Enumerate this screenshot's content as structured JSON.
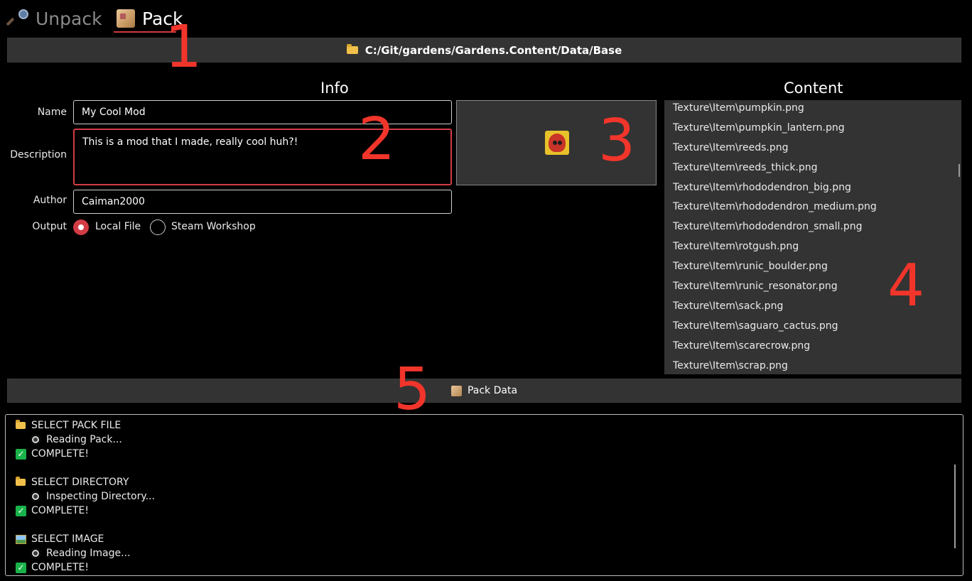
{
  "tabs": [
    {
      "label": "Unpack",
      "icon": "magnifier-icon",
      "active": false
    },
    {
      "label": "Pack",
      "icon": "package-icon",
      "active": true
    }
  ],
  "path_bar": {
    "icon": "folder-icon",
    "path": "C:/Git/gardens/Gardens.Content/Data/Base"
  },
  "info": {
    "heading": "Info",
    "name_label": "Name",
    "name_value": "My Cool Mod",
    "description_label": "Description",
    "description_value": "This is a mod that I made, really cool huh?!",
    "author_label": "Author",
    "author_value": "Caiman2000",
    "output_label": "Output",
    "output_options": [
      "Local File",
      "Steam Workshop"
    ],
    "output_selected": "Local File"
  },
  "content": {
    "heading": "Content",
    "items": [
      "Texture\\Item\\pumpkin.png",
      "Texture\\Item\\pumpkin_lantern.png",
      "Texture\\Item\\reeds.png",
      "Texture\\Item\\reeds_thick.png",
      "Texture\\Item\\rhododendron_big.png",
      "Texture\\Item\\rhododendron_medium.png",
      "Texture\\Item\\rhododendron_small.png",
      "Texture\\Item\\rotgush.png",
      "Texture\\Item\\runic_boulder.png",
      "Texture\\Item\\runic_resonator.png",
      "Texture\\Item\\sack.png",
      "Texture\\Item\\saguaro_cactus.png",
      "Texture\\Item\\scarecrow.png",
      "Texture\\Item\\scrap.png"
    ]
  },
  "pack_button": {
    "label": "Pack Data",
    "icon": "package-icon"
  },
  "log": {
    "lines": [
      {
        "icon": "folder-icon",
        "text": "SELECT PACK FILE",
        "indent": false
      },
      {
        "icon": "gear-icon",
        "text": "Reading Pack...",
        "indent": true
      },
      {
        "icon": "check-icon",
        "text": "COMPLETE!",
        "indent": false
      },
      {
        "icon": "folder-icon",
        "text": "SELECT DIRECTORY",
        "indent": false
      },
      {
        "icon": "gear-icon",
        "text": "Inspecting Directory...",
        "indent": true
      },
      {
        "icon": "check-icon",
        "text": "COMPLETE!",
        "indent": false
      },
      {
        "icon": "image-icon",
        "text": "SELECT IMAGE",
        "indent": false
      },
      {
        "icon": "gear-icon",
        "text": "Reading Image...",
        "indent": true
      },
      {
        "icon": "check-icon",
        "text": "COMPLETE!",
        "indent": false
      }
    ]
  },
  "annotations": [
    "1",
    "2",
    "3",
    "4",
    "5"
  ],
  "colors": {
    "accent": "#d23c45",
    "annotation": "#f2352b",
    "panel": "#333333",
    "check": "#19b34a"
  }
}
